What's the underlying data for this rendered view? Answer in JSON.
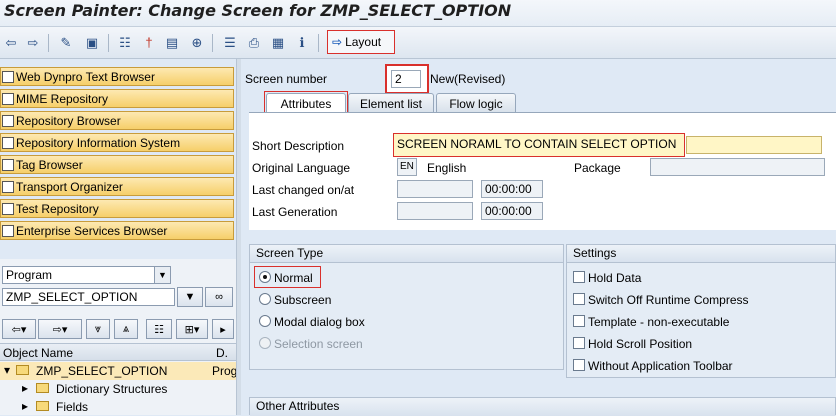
{
  "window": {
    "title": "Screen Painter: Change Screen for ZMP_SELECT_OPTION"
  },
  "toolbar": {
    "icons": [
      "back-arrow-icon",
      "forward-arrow-icon",
      "edit-toggle-icon",
      "other-object-icon",
      "hierarchy-icon",
      "activate-icon",
      "display-icon",
      "navigate-icon",
      "screen-structure-icon",
      "print-icon",
      "element-list-icon",
      "info-icon"
    ],
    "layout_label": "Layout"
  },
  "navigator": {
    "buttons": [
      "Web Dynpro Text Browser",
      "MIME Repository",
      "Repository Browser",
      "Repository Information System",
      "Tag Browser",
      "Transport Organizer",
      "Test Repository",
      "Enterprise Services Browser"
    ],
    "object_type": "Program",
    "object_name": "ZMP_SELECT_OPTION",
    "tree_columns": [
      "Object Name",
      "D."
    ],
    "tree_rows": [
      {
        "name": "ZMP_SELECT_OPTION",
        "desc": "Prog"
      },
      {
        "name": "Dictionary Structures",
        "desc": ""
      },
      {
        "name": "Fields",
        "desc": ""
      }
    ]
  },
  "screen": {
    "number_label": "Screen number",
    "number_value": "2",
    "status": "New(Revised)",
    "tabs": [
      "Attributes",
      "Element list",
      "Flow logic"
    ],
    "short_desc_label": "Short Description",
    "short_desc_value": "SCREEN NORAML TO CONTAIN SELECT OPTION",
    "orig_lang_label": "Original Language",
    "orig_lang_code": "EN",
    "orig_lang_name": "English",
    "package_label": "Package",
    "last_changed_label": "Last changed on/at",
    "last_changed_time": "00:00:00",
    "last_gen_label": "Last Generation",
    "last_gen_time": "00:00:00"
  },
  "screen_type": {
    "title": "Screen Type",
    "options": [
      "Normal",
      "Subscreen",
      "Modal dialog box",
      "Selection screen"
    ],
    "selected": "Normal"
  },
  "settings": {
    "title": "Settings",
    "options": [
      "Hold Data",
      "Switch Off Runtime Compress",
      "Template - non-executable",
      "Hold Scroll Position",
      "Without Application Toolbar"
    ]
  },
  "other_attributes": {
    "title": "Other Attributes"
  }
}
